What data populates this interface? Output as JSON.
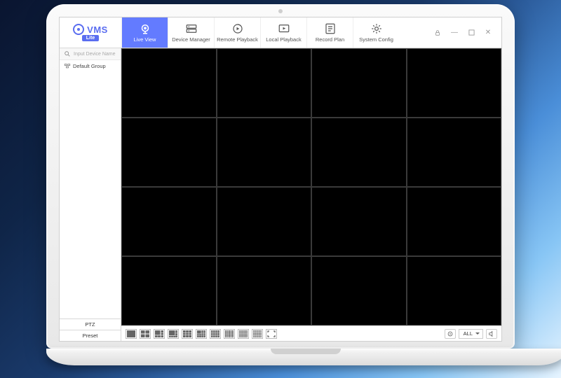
{
  "logo": {
    "brand": "VMS",
    "badge": "Lite"
  },
  "toolbar": {
    "items": [
      {
        "label": "Live View"
      },
      {
        "label": "Device Manager"
      },
      {
        "label": "Remote Playback"
      },
      {
        "label": "Local Playback"
      },
      {
        "label": "Record Plan"
      },
      {
        "label": "System Config"
      }
    ]
  },
  "sidebar": {
    "search_placeholder": "Input Device Name",
    "root_label": "Default Group",
    "ptz": "PTZ",
    "preset": "Preset"
  },
  "footer": {
    "stream_select": "ALL"
  }
}
